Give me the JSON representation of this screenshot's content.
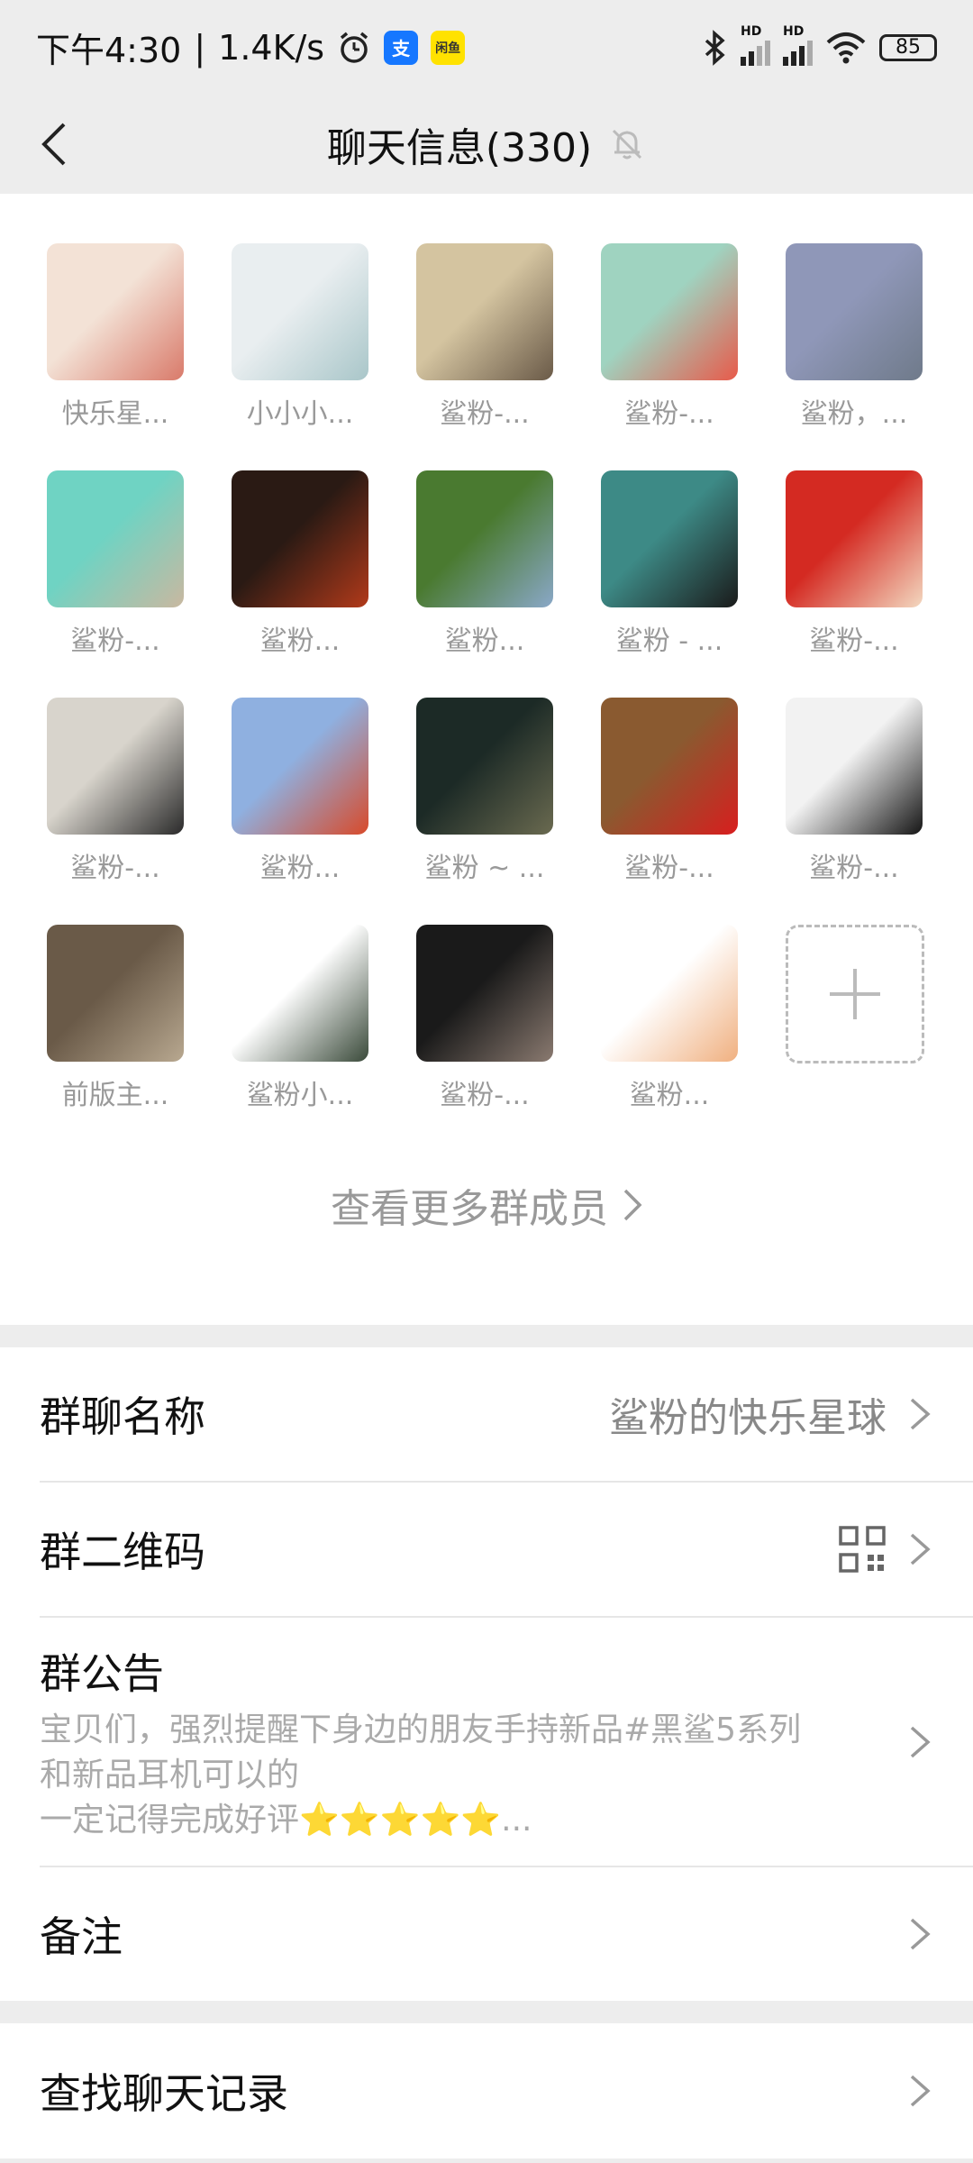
{
  "status_bar": {
    "time": "下午4:30",
    "separator": "|",
    "net_speed": "1.4K/s",
    "alipay_label": "支",
    "xianyu_label": "闲鱼",
    "battery": "85",
    "hd_label": "HD"
  },
  "header": {
    "title": "聊天信息(330)"
  },
  "members": [
    {
      "name": "快乐星...",
      "color1": "#f3e2d6",
      "color2": "#d97a6a"
    },
    {
      "name": "小小小...",
      "color1": "#e9eef0",
      "color2": "#a9c6c9"
    },
    {
      "name": "鲨粉-...",
      "color1": "#d4c4a0",
      "color2": "#6a5a48"
    },
    {
      "name": "鲨粉-...",
      "color1": "#9fd3c0",
      "color2": "#e85a4a"
    },
    {
      "name": "鲨粉，...",
      "color1": "#8f97b8",
      "color2": "#6f7a8a"
    },
    {
      "name": "鲨粉-...",
      "color1": "#6fd3c3",
      "color2": "#c9b8a0"
    },
    {
      "name": "鲨粉...",
      "color1": "#2a1a14",
      "color2": "#b23a1a"
    },
    {
      "name": "鲨粉...",
      "color1": "#4a7a30",
      "color2": "#8aa8c8"
    },
    {
      "name": "鲨粉 - ...",
      "color1": "#3d8a86",
      "color2": "#1a1a1a"
    },
    {
      "name": "鲨粉-...",
      "color1": "#d42a22",
      "color2": "#f3d8c0"
    },
    {
      "name": "鲨粉-...",
      "color1": "#d8d4cc",
      "color2": "#2a2a2a"
    },
    {
      "name": "鲨粉...",
      "color1": "#8fb0e0",
      "color2": "#d84a2a"
    },
    {
      "name": "鲨粉 ~ ...",
      "color1": "#1c2a26",
      "color2": "#6a6a50"
    },
    {
      "name": "鲨粉-...",
      "color1": "#8a5a30",
      "color2": "#d81e1e"
    },
    {
      "name": "鲨粉-...",
      "color1": "#f2f2f2",
      "color2": "#151515"
    },
    {
      "name": "前版主...",
      "color1": "#6a5a48",
      "color2": "#b8a890"
    },
    {
      "name": "鲨粉小...",
      "color1": "#ffffff",
      "color2": "#3a4a3a"
    },
    {
      "name": "鲨粉-...",
      "color1": "#1a1a1a",
      "color2": "#8a7a70"
    },
    {
      "name": "鲨粉...",
      "color1": "#ffffff",
      "color2": "#f0b080"
    }
  ],
  "more_members_label": "查看更多群成员",
  "settings": {
    "group_name_label": "群聊名称",
    "group_name_value": "鲨粉的快乐星球",
    "qr_label": "群二维码",
    "notice_label": "群公告",
    "notice_line1": "宝贝们，强烈提醒下身边的朋友手持新品#黑鲨5系列",
    "notice_line2": "和新品耳机可以的",
    "notice_line3": "一定记得完成好评⭐⭐⭐⭐⭐...",
    "remark_label": "备注",
    "search_label": "查找聊天记录"
  },
  "colors": {
    "background": "#ededed",
    "panel": "#ffffff",
    "muted_text": "#999999"
  }
}
